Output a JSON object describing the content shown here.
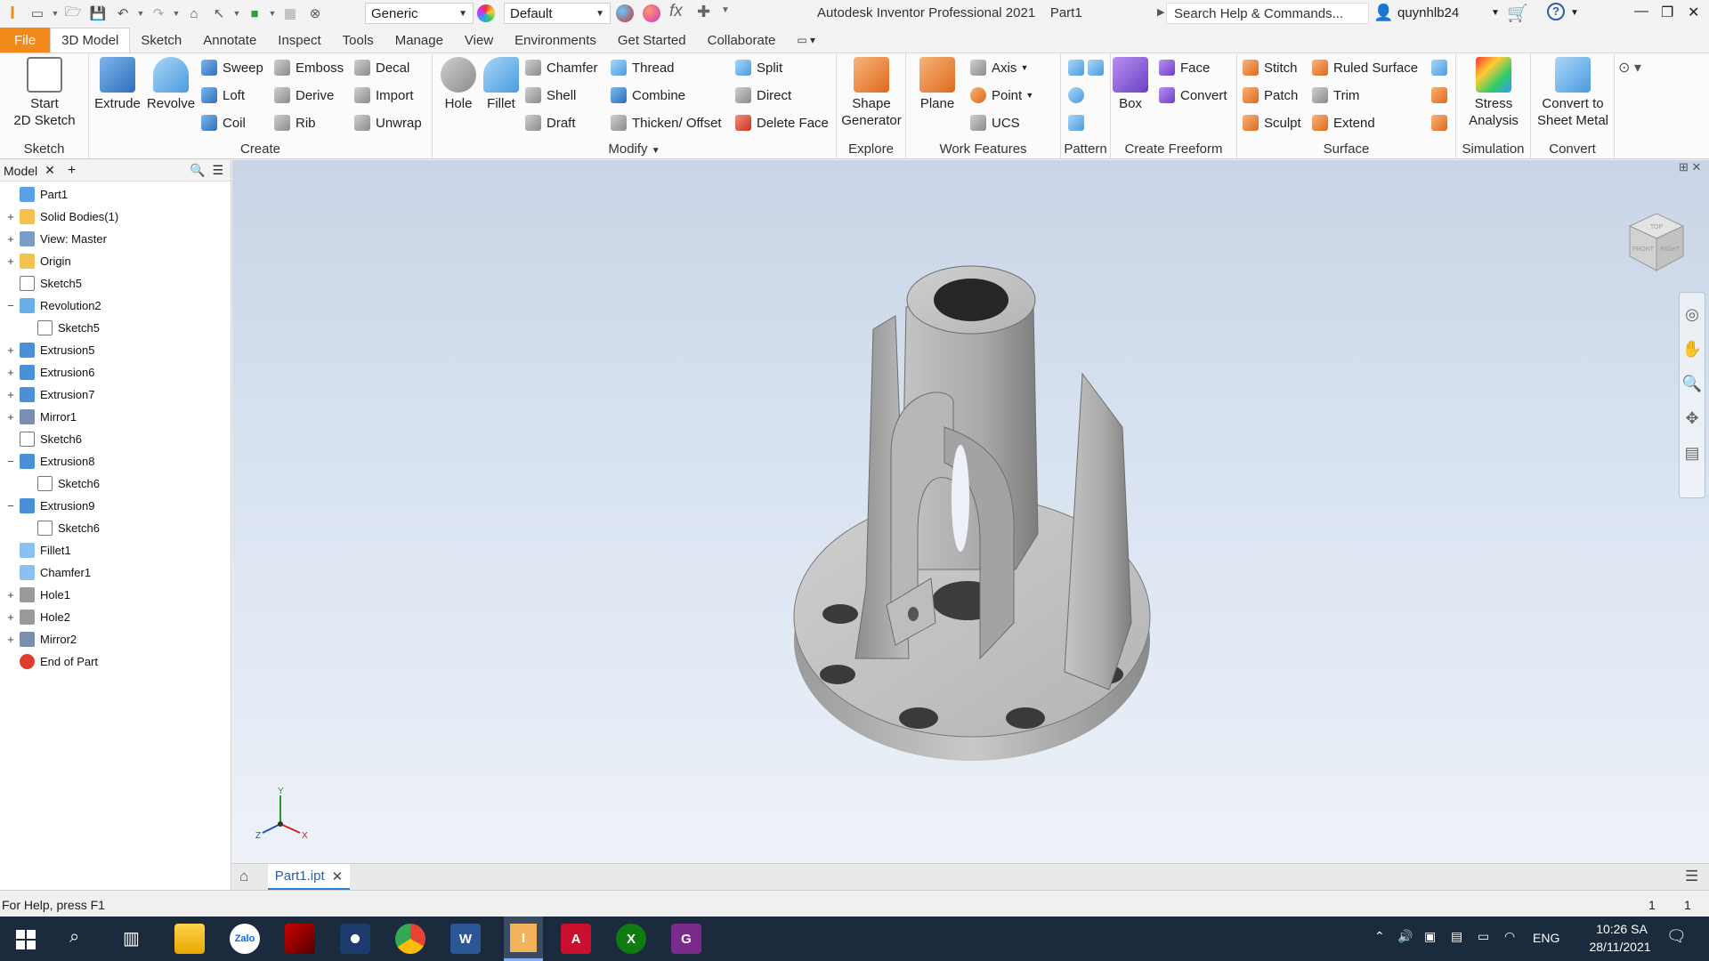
{
  "titlebar": {
    "material_combo": "Generic",
    "appearance_combo": "Default",
    "app_title": "Autodesk Inventor Professional 2021",
    "doc_title": "Part1",
    "search_placeholder": "Search Help & Commands...",
    "user": "quynhlb24"
  },
  "tabs": [
    "File",
    "3D Model",
    "Sketch",
    "Annotate",
    "Inspect",
    "Tools",
    "Manage",
    "View",
    "Environments",
    "Get Started",
    "Collaborate"
  ],
  "ribbon": {
    "sketch": {
      "label": "Sketch",
      "start_sketch": "Start\n2D Sketch"
    },
    "create": {
      "label": "Create",
      "extrude": "Extrude",
      "revolve": "Revolve",
      "sweep": "Sweep",
      "emboss": "Emboss",
      "decal": "Decal",
      "loft": "Loft",
      "derive": "Derive",
      "import": "Import",
      "coil": "Coil",
      "rib": "Rib",
      "unwrap": "Unwrap"
    },
    "modify": {
      "label": "Modify",
      "hole": "Hole",
      "fillet": "Fillet",
      "chamfer": "Chamfer",
      "thread": "Thread",
      "split": "Split",
      "shell": "Shell",
      "combine": "Combine",
      "direct": "Direct",
      "draft": "Draft",
      "thicken": "Thicken/ Offset",
      "delete_face": "Delete Face"
    },
    "explore": {
      "label": "Explore",
      "shape_generator": "Shape\nGenerator"
    },
    "work_features": {
      "label": "Work Features",
      "plane": "Plane",
      "axis": "Axis",
      "point": "Point",
      "ucs": "UCS"
    },
    "pattern": {
      "label": "Pattern"
    },
    "freeform": {
      "label": "Create Freeform",
      "box": "Box",
      "face": "Face",
      "convert": "Convert"
    },
    "surface": {
      "label": "Surface",
      "stitch": "Stitch",
      "ruled": "Ruled Surface",
      "patch": "Patch",
      "trim": "Trim",
      "sculpt": "Sculpt",
      "extend": "Extend"
    },
    "simulation": {
      "label": "Simulation",
      "stress": "Stress\nAnalysis"
    },
    "convert": {
      "label": "Convert",
      "sheet_metal": "Convert to\nSheet Metal"
    }
  },
  "browser": {
    "tab_label": "Model",
    "items": [
      {
        "label": "Part1",
        "toggle": "",
        "indent": 0,
        "icon": "part-icon"
      },
      {
        "label": "Solid Bodies(1)",
        "toggle": "+",
        "indent": 0,
        "icon": "folder-icon"
      },
      {
        "label": "View: Master",
        "toggle": "+",
        "indent": 0,
        "icon": "view-icon"
      },
      {
        "label": "Origin",
        "toggle": "+",
        "indent": 0,
        "icon": "folder-icon"
      },
      {
        "label": "Sketch5",
        "toggle": "",
        "indent": 0,
        "icon": "sketch-icon"
      },
      {
        "label": "Revolution2",
        "toggle": "−",
        "indent": 0,
        "icon": "revolve-icon"
      },
      {
        "label": "Sketch5",
        "toggle": "",
        "indent": 1,
        "icon": "sketch-icon"
      },
      {
        "label": "Extrusion5",
        "toggle": "+",
        "indent": 0,
        "icon": "extrude-icon"
      },
      {
        "label": "Extrusion6",
        "toggle": "+",
        "indent": 0,
        "icon": "extrude-icon"
      },
      {
        "label": "Extrusion7",
        "toggle": "+",
        "indent": 0,
        "icon": "extrude-icon"
      },
      {
        "label": "Mirror1",
        "toggle": "+",
        "indent": 0,
        "icon": "mirror-icon"
      },
      {
        "label": "Sketch6",
        "toggle": "",
        "indent": 0,
        "icon": "sketch-icon"
      },
      {
        "label": "Extrusion8",
        "toggle": "−",
        "indent": 0,
        "icon": "extrude-icon"
      },
      {
        "label": "Sketch6",
        "toggle": "",
        "indent": 1,
        "icon": "sketch-icon"
      },
      {
        "label": "Extrusion9",
        "toggle": "−",
        "indent": 0,
        "icon": "extrude-icon"
      },
      {
        "label": "Sketch6",
        "toggle": "",
        "indent": 1,
        "icon": "sketch-icon"
      },
      {
        "label": "Fillet1",
        "toggle": "",
        "indent": 0,
        "icon": "fillet-icon"
      },
      {
        "label": "Chamfer1",
        "toggle": "",
        "indent": 0,
        "icon": "chamfer-icon"
      },
      {
        "label": "Hole1",
        "toggle": "+",
        "indent": 0,
        "icon": "hole-icon"
      },
      {
        "label": "Hole2",
        "toggle": "+",
        "indent": 0,
        "icon": "hole-icon"
      },
      {
        "label": "Mirror2",
        "toggle": "+",
        "indent": 0,
        "icon": "mirror-icon"
      },
      {
        "label": "End of Part",
        "toggle": "",
        "indent": 0,
        "icon": "end-of-part-icon"
      }
    ]
  },
  "viewcube": {
    "top": "TOP",
    "front": "FRONT",
    "right": "RIGHT"
  },
  "triad": {
    "x": "X",
    "y": "Y",
    "z": "Z"
  },
  "doc_tab": "Part1.ipt",
  "status": {
    "help": "For Help, press F1",
    "count1": "1",
    "count2": "1"
  },
  "taskbar": {
    "lang": "ENG",
    "time": "10:26 SA",
    "date": "28/11/2021",
    "zalo": "Zalo"
  }
}
